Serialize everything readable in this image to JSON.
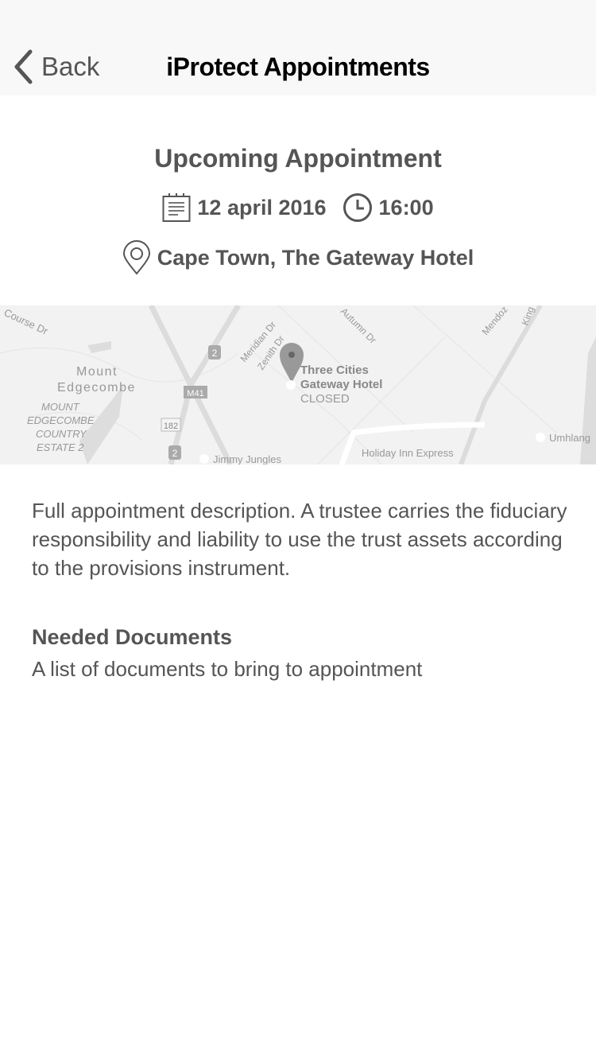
{
  "nav": {
    "back_label": "Back",
    "title": "iProtect Appointments"
  },
  "appointment": {
    "heading": "Upcoming Appointment",
    "date": "12 april 2016",
    "time": "16:00",
    "location": "Cape Town, The Gateway Hotel"
  },
  "map": {
    "labels": {
      "course": "Course Dr",
      "mount1": "Mount",
      "mount2": "Edgecombe",
      "estate1": "MOUNT",
      "estate2": "EDGECOMBE",
      "estate3": "COUNTRY",
      "estate4": "ESTATE 2",
      "meridian": "Meridian Dr",
      "zenith": "Zenith Dr",
      "autumn": "Autumn Dr",
      "mendoza": "Mendoz",
      "king": "King",
      "r2": "2",
      "r2b": "2",
      "m41": "M41",
      "r182": "182",
      "hotel1": "Three Cities",
      "hotel2": "Gateway Hotel",
      "hotel_status": "CLOSED",
      "jimmy": "Jimmy Jungles",
      "holiday": "Holiday Inn Express",
      "umhlanga": "Umhlang"
    }
  },
  "description": "Full appointment description. A trustee carries the fiduciary responsibility and liability to use the trust assets according to the provisions instrument.",
  "documents": {
    "title": "Needed Documents",
    "text": "A list of documents to bring to appointment"
  }
}
